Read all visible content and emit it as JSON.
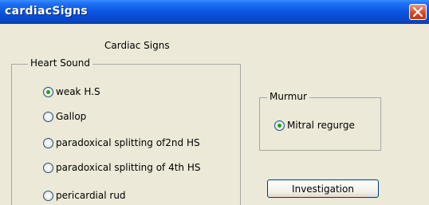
{
  "window": {
    "title": "cardiacSigns"
  },
  "form": {
    "heading": "Cardiac Signs"
  },
  "heart_sound": {
    "legend": "Heart Sound",
    "options": [
      {
        "label": "weak H.S",
        "checked": true
      },
      {
        "label": "Gallop",
        "checked": false
      },
      {
        "label": "paradoxical splitting of2nd HS",
        "checked": false
      },
      {
        "label": "paradoxical splitting of 4th HS",
        "checked": false
      },
      {
        "label": "pericardial rud",
        "checked": false
      }
    ]
  },
  "murmur": {
    "legend": "Murmur",
    "options": [
      {
        "label": "Mitral regurge",
        "checked": true
      }
    ]
  },
  "buttons": {
    "investigation": "Investigation"
  },
  "colors": {
    "titlebar": "#0a55e0",
    "radio_dot": "#21a121",
    "window_bg": "#ece9d8"
  }
}
